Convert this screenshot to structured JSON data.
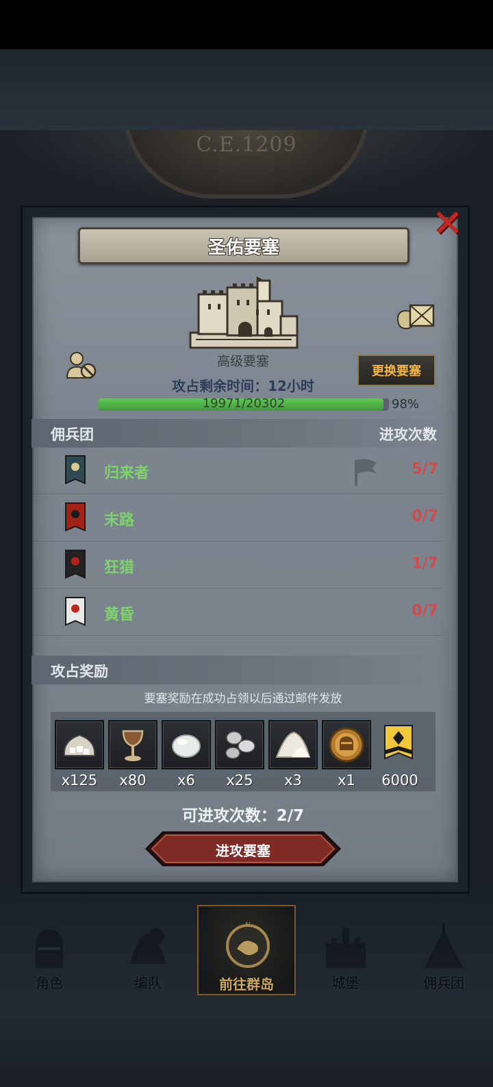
{
  "background": {
    "era_label": "C.E.1209"
  },
  "fortress": {
    "title": "圣佑要塞",
    "type_label": "高级要塞",
    "change_button": "更换要塞",
    "time_remaining": "攻占剩余时间：12小时",
    "progress_text": "19971/20302",
    "progress_pct_text": "98%",
    "progress_fraction": 0.98
  },
  "mercenaries": {
    "header_left": "佣兵团",
    "header_right": "进攻次数",
    "rows": [
      {
        "name": "归来者",
        "count": "5/7",
        "banner_color": "#2e4a52",
        "emblem_color": "#d9c98a",
        "has_flag": true
      },
      {
        "name": "末路",
        "count": "0/7",
        "banner_color": "#a32216",
        "emblem_color": "#1b1b1b",
        "has_flag": false
      },
      {
        "name": "狂猎",
        "count": "1/7",
        "banner_color": "#232323",
        "emblem_color": "#b3211a",
        "has_flag": false
      },
      {
        "name": "黄昏",
        "count": "0/7",
        "banner_color": "#e9e9e9",
        "emblem_color": "#c0251c",
        "has_flag": false
      }
    ]
  },
  "rewards": {
    "header": "攻占奖励",
    "notice": "要塞奖励在成功占领以后通过邮件发放",
    "items": [
      {
        "icon": "silver-ore-sack-icon",
        "qty": "x125"
      },
      {
        "icon": "goblet-icon",
        "qty": "x80"
      },
      {
        "icon": "moonstone-icon",
        "qty": "x6"
      },
      {
        "icon": "silver-pebbles-icon",
        "qty": "x25"
      },
      {
        "icon": "salt-pile-icon",
        "qty": "x3"
      },
      {
        "icon": "knight-medal-icon",
        "qty": "x1"
      },
      {
        "icon": "honor-banner-icon",
        "qty": "6000"
      }
    ]
  },
  "attack": {
    "attempts_label": "可进攻次数：2/7",
    "button": "进攻要塞"
  },
  "nav": {
    "items": [
      {
        "label": "角色",
        "icon": "knight-helmet-icon",
        "active": false
      },
      {
        "label": "编队",
        "icon": "formation-icon",
        "active": false
      },
      {
        "label": "前往群岛",
        "icon": "compass-island-icon",
        "active": true
      },
      {
        "label": "城堡",
        "icon": "castle-icon",
        "active": false
      },
      {
        "label": "佣兵团",
        "icon": "mercenary-tent-icon",
        "active": false
      }
    ]
  }
}
